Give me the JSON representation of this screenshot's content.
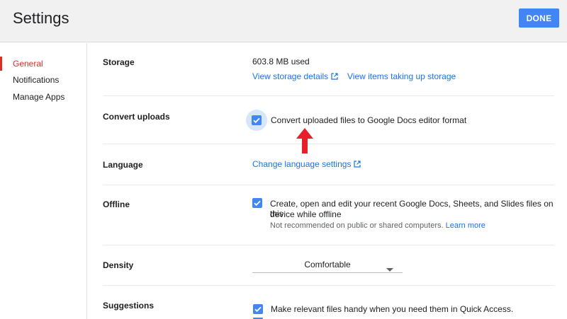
{
  "header": {
    "title": "Settings",
    "done_label": "DONE"
  },
  "sidebar": {
    "items": [
      {
        "label": "General",
        "active": true
      },
      {
        "label": "Notifications",
        "active": false
      },
      {
        "label": "Manage Apps",
        "active": false
      }
    ]
  },
  "sections": {
    "storage": {
      "label": "Storage",
      "used": "603.8 MB used",
      "details_link": "View storage details",
      "items_link": "View items taking up storage"
    },
    "convert": {
      "label": "Convert uploads",
      "checkbox_label": "Convert uploaded files to Google Docs editor format",
      "checked": true
    },
    "language": {
      "label": "Language",
      "link": "Change language settings"
    },
    "offline": {
      "label": "Offline",
      "line1": "Create, open and edit your recent Google Docs, Sheets, and Slides files on this",
      "line2": "device while offline",
      "note": "Not recommended on public or shared computers.",
      "learn_more": "Learn more",
      "checked": true
    },
    "density": {
      "label": "Density",
      "selected": "Comfortable"
    },
    "suggestions": {
      "label": "Suggestions",
      "checkbox_label": "Make relevant files handy when you need them in Quick Access.",
      "checked": true
    }
  },
  "colors": {
    "accent": "#4285f4",
    "active_nav": "#d93025",
    "link": "#1a73e8",
    "annotation_arrow": "#e8202a"
  }
}
